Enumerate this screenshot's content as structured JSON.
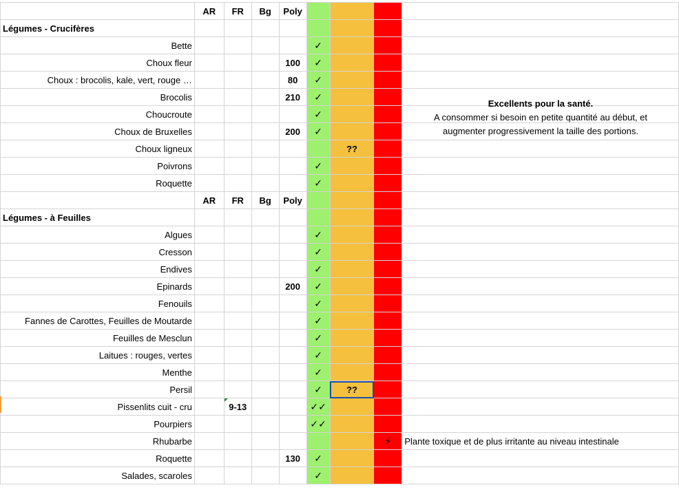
{
  "headers": {
    "ar": "AR",
    "fr": "FR",
    "bg": "Bg",
    "poly": "Poly"
  },
  "sections": {
    "cruciferes": "Légumes - Crucifères",
    "feuilles": "Légumes - à Feuilles"
  },
  "marks": {
    "check": "✓",
    "double_check": "✓✓",
    "question": "??",
    "bolt": "⚡"
  },
  "note": {
    "title": "Excellents pour la santé.",
    "line1": "A consommer si besoin en petite quantité au début, et",
    "line2": "augmenter progressivement la taille des portions."
  },
  "rows_cruciferes": [
    {
      "name": "Bette",
      "ar": "",
      "fr": "",
      "bg": "",
      "poly": "",
      "green": "✓",
      "orange": "",
      "red": "",
      "note": ""
    },
    {
      "name": "Choux fleur",
      "ar": "",
      "fr": "",
      "bg": "",
      "poly": "100",
      "green": "✓",
      "orange": "",
      "red": "",
      "note": ""
    },
    {
      "name": "Choux : brocolis, kale, vert, rouge …",
      "ar": "",
      "fr": "",
      "bg": "",
      "poly": "80",
      "green": "✓",
      "orange": "",
      "red": "",
      "note": ""
    },
    {
      "name": "Brocolis",
      "ar": "",
      "fr": "",
      "bg": "",
      "poly": "210",
      "green": "✓",
      "orange": "",
      "red": "",
      "note": ""
    },
    {
      "name": "Choucroute",
      "ar": "",
      "fr": "",
      "bg": "",
      "poly": "",
      "green": "✓",
      "orange": "",
      "red": "",
      "note": ""
    },
    {
      "name": "Choux de Bruxelles",
      "ar": "",
      "fr": "",
      "bg": "",
      "poly": "200",
      "green": "✓",
      "orange": "",
      "red": "",
      "note": ""
    },
    {
      "name": "Choux ligneux",
      "ar": "",
      "fr": "",
      "bg": "",
      "poly": "",
      "green": "",
      "orange": "??",
      "red": "",
      "note": ""
    },
    {
      "name": "Poivrons",
      "ar": "",
      "fr": "",
      "bg": "",
      "poly": "",
      "green": "✓",
      "orange": "",
      "red": "",
      "note": ""
    },
    {
      "name": "Roquette",
      "ar": "",
      "fr": "",
      "bg": "",
      "poly": "",
      "green": "✓",
      "orange": "",
      "red": "",
      "note": ""
    }
  ],
  "rows_feuilles": [
    {
      "name": "Algues",
      "ar": "",
      "fr": "",
      "bg": "",
      "poly": "",
      "green": "✓",
      "orange": "",
      "red": "",
      "note": ""
    },
    {
      "name": "Cresson",
      "ar": "",
      "fr": "",
      "bg": "",
      "poly": "",
      "green": "✓",
      "orange": "",
      "red": "",
      "note": ""
    },
    {
      "name": "Endives",
      "ar": "",
      "fr": "",
      "bg": "",
      "poly": "",
      "green": "✓",
      "orange": "",
      "red": "",
      "note": ""
    },
    {
      "name": "Epinards",
      "ar": "",
      "fr": "",
      "bg": "",
      "poly": "200",
      "green": "✓",
      "orange": "",
      "red": "",
      "note": ""
    },
    {
      "name": "Fenouils",
      "ar": "",
      "fr": "",
      "bg": "",
      "poly": "",
      "green": "✓",
      "orange": "",
      "red": "",
      "note": ""
    },
    {
      "name": "Fannes de Carottes, Feuilles de Moutarde",
      "ar": "",
      "fr": "",
      "bg": "",
      "poly": "",
      "green": "✓",
      "orange": "",
      "red": "",
      "note": ""
    },
    {
      "name": "Feuilles de Mesclun",
      "ar": "",
      "fr": "",
      "bg": "",
      "poly": "",
      "green": "✓",
      "orange": "",
      "red": "",
      "note": ""
    },
    {
      "name": "Laitues : rouges, vertes",
      "ar": "",
      "fr": "",
      "bg": "",
      "poly": "",
      "green": "✓",
      "orange": "",
      "red": "",
      "note": ""
    },
    {
      "name": "Menthe",
      "ar": "",
      "fr": "",
      "bg": "",
      "poly": "",
      "green": "✓",
      "orange": "",
      "red": "",
      "note": ""
    },
    {
      "name": "Persil",
      "ar": "",
      "fr": "",
      "bg": "",
      "poly": "",
      "green": "✓",
      "orange": "??",
      "red": "",
      "note": "",
      "selected": true
    },
    {
      "name": "Pissenlits cuit - cru",
      "ar": "",
      "fr": "9-13",
      "bg": "",
      "poly": "",
      "green": "✓✓",
      "orange": "",
      "red": "",
      "note": "",
      "comment": true
    },
    {
      "name": "Pourpiers",
      "ar": "",
      "fr": "",
      "bg": "",
      "poly": "",
      "green": "✓✓",
      "orange": "",
      "red": "",
      "note": ""
    },
    {
      "name": "Rhubarbe",
      "ar": "",
      "fr": "",
      "bg": "",
      "poly": "",
      "green": "",
      "orange": "",
      "red": "⚡",
      "note": "Plante toxique et de plus irritante au niveau intestinale"
    },
    {
      "name": "Roquette",
      "ar": "",
      "fr": "",
      "bg": "",
      "poly": "130",
      "green": "✓",
      "orange": "",
      "red": "",
      "note": ""
    },
    {
      "name": "Salades, scaroles",
      "ar": "",
      "fr": "",
      "bg": "",
      "poly": "",
      "green": "✓",
      "orange": "",
      "red": "",
      "note": ""
    }
  ],
  "colors": {
    "green": "#9ef06f",
    "orange": "#f4c03d",
    "red": "#fe0000",
    "selection": "#1f4ea8"
  }
}
